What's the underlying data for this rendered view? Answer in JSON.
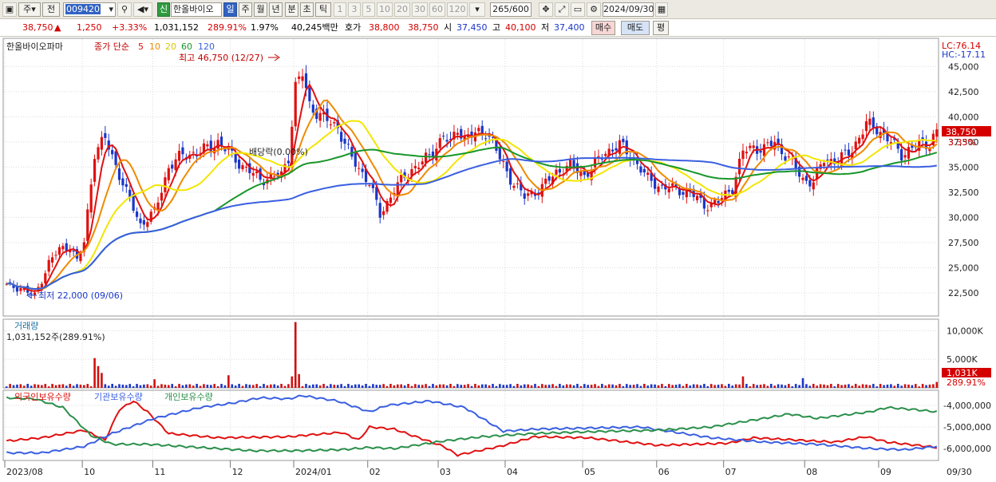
{
  "toolbar": {
    "stock_type": "주",
    "full_label": "전",
    "code": "009420",
    "sin_badge": "신",
    "stock_name": "한올바이오",
    "periods": [
      "일",
      "주",
      "월",
      "년",
      "분",
      "초",
      "틱"
    ],
    "intervals": [
      "1",
      "3",
      "5",
      "10",
      "20",
      "30",
      "60",
      "120"
    ],
    "bars": "265/600",
    "date": "2024/09/30"
  },
  "quote": {
    "price": "38,750",
    "change": "1,250",
    "change_pct": "+3.33%",
    "volume": "1,031,152",
    "volume_ratio": "289.91%",
    "turnover_pct": "1.97%",
    "amount": "40,245백만",
    "hoga_label": "호가",
    "ask": "38,800",
    "bid": "38,750",
    "open_label": "시",
    "open": "37,450",
    "high_label": "고",
    "high": "40,100",
    "low_label": "저",
    "low": "37,400",
    "buy_btn": "매수",
    "sell_btn": "매도",
    "eval_btn": "평"
  },
  "price_pane": {
    "title": "한올바이오파마",
    "ma_label": "종가 단순",
    "ma_periods": [
      "5",
      "10",
      "20",
      "60",
      "120"
    ],
    "ma_colors": [
      "#e01010",
      "#f08a00",
      "#f3e600",
      "#18962a",
      "#3a5fe0"
    ],
    "high_annot": "최고 46,750 (12/27)",
    "low_annot": "최저 22,000 (09/06)",
    "div_annot": "배당락(0.00%)",
    "lc": "LC:76.14",
    "hc": "HC:-17.11",
    "last_price": "38,750",
    "last_pct": "3.33%",
    "axis_ticks": [
      "45,000",
      "42,500",
      "40,000",
      "37,500",
      "35,000",
      "32,500",
      "30,000",
      "27,500",
      "25,000",
      "22,500"
    ]
  },
  "volume_pane": {
    "title": "거래량",
    "value": "1,031,152주(289.91%)",
    "axis_ticks": [
      "10,000K",
      "5,000K"
    ],
    "last": "1,031K",
    "last_pct": "289.91%"
  },
  "holding_pane": {
    "series": [
      {
        "name": "외국인보유수량",
        "color": "#e01010"
      },
      {
        "name": "기관보유수량",
        "color": "#3a5fe0"
      },
      {
        "name": "개인보유수량",
        "color": "#2a8f4a"
      }
    ],
    "axis_ticks": [
      "-4,000,000",
      "-5,000,000",
      "-6,000,000"
    ]
  },
  "x_axis": {
    "labels": [
      "2023/08",
      "10",
      "11",
      "12",
      "2024/01",
      "02",
      "03",
      "04",
      "05",
      "06",
      "07",
      "08",
      "09"
    ],
    "end_label": "09/30"
  }
}
